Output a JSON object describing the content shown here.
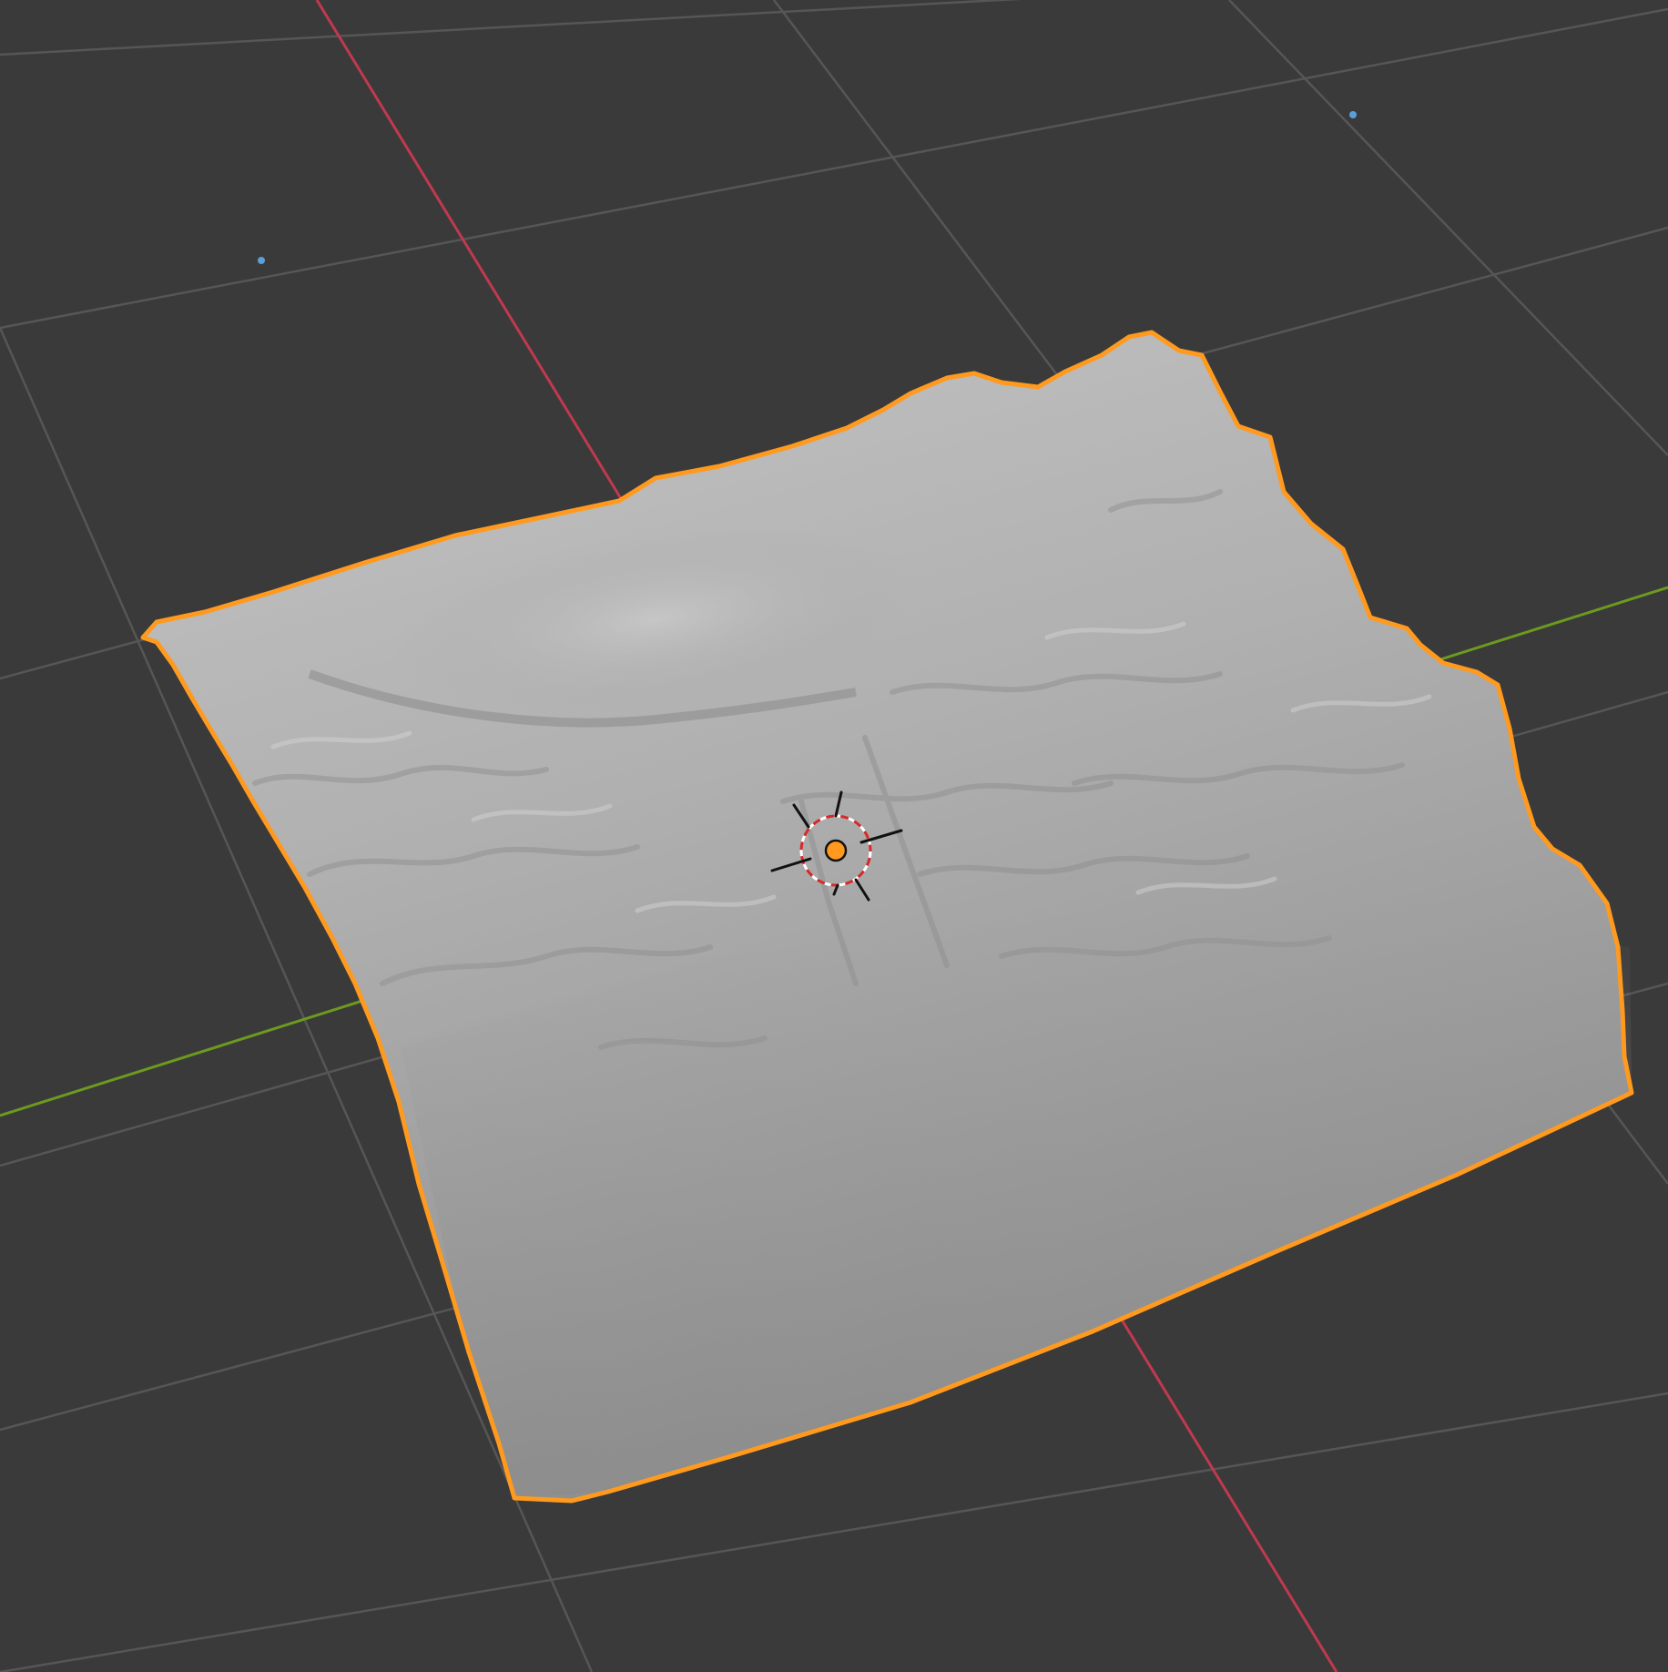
{
  "viewport": {
    "view": "3d-viewport",
    "shading": "solid",
    "background_color": "#3a3a3a",
    "grid_color": "#545454",
    "x_axis_color": "#c0394f",
    "y_axis_color": "#6c9a1f",
    "selection_outline_color": "#ff9a1f",
    "mesh_color": "#a9a9a9",
    "origin_color": "#ff9a1f",
    "light_marker_color": "#5a9fd8"
  },
  "scene": {
    "selected_object": {
      "type": "terrain-mesh",
      "selected": true
    },
    "cursor": {
      "icon": "3d-cursor-icon"
    },
    "markers": [
      {
        "icon": "light-point-icon"
      },
      {
        "icon": "light-point-icon"
      }
    ]
  }
}
